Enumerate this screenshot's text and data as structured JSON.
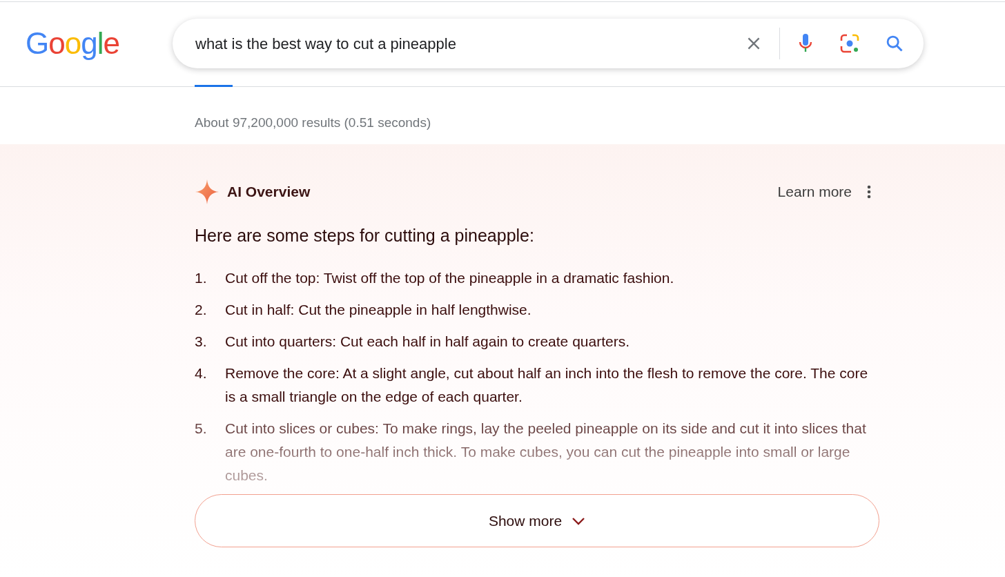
{
  "logo": {
    "text": "Google"
  },
  "search": {
    "value": "what is the best way to cut a pineapple"
  },
  "tabs_indicator": {
    "selected": true
  },
  "results_stats": "About 97,200,000 results (0.51 seconds)",
  "ai_overview": {
    "title": "AI Overview",
    "learn_more": "Learn more",
    "heading": "Here are some steps for cutting a pineapple:",
    "steps": [
      {
        "number": "1.",
        "text": "Cut off the top: Twist off the top of the pineapple in a dramatic fashion.",
        "faded": false
      },
      {
        "number": "2.",
        "text": "Cut in half: Cut the pineapple in half lengthwise.",
        "faded": false
      },
      {
        "number": "3.",
        "text": "Cut into quarters: Cut each half in half again to create quarters.",
        "faded": false
      },
      {
        "number": "4.",
        "text": "Remove the core: At a slight angle, cut about half an inch into the flesh to remove the core. The core is a small triangle on the edge of each quarter.",
        "faded": false
      },
      {
        "number": "5.",
        "text": "Cut into slices or cubes: To make rings, lay the peeled pineapple on its side and cut it into slices that are one-fourth to one-half inch thick. To make cubes, you can cut the pineapple into small or large cubes.",
        "faded": true
      }
    ],
    "show_more": "Show more"
  }
}
